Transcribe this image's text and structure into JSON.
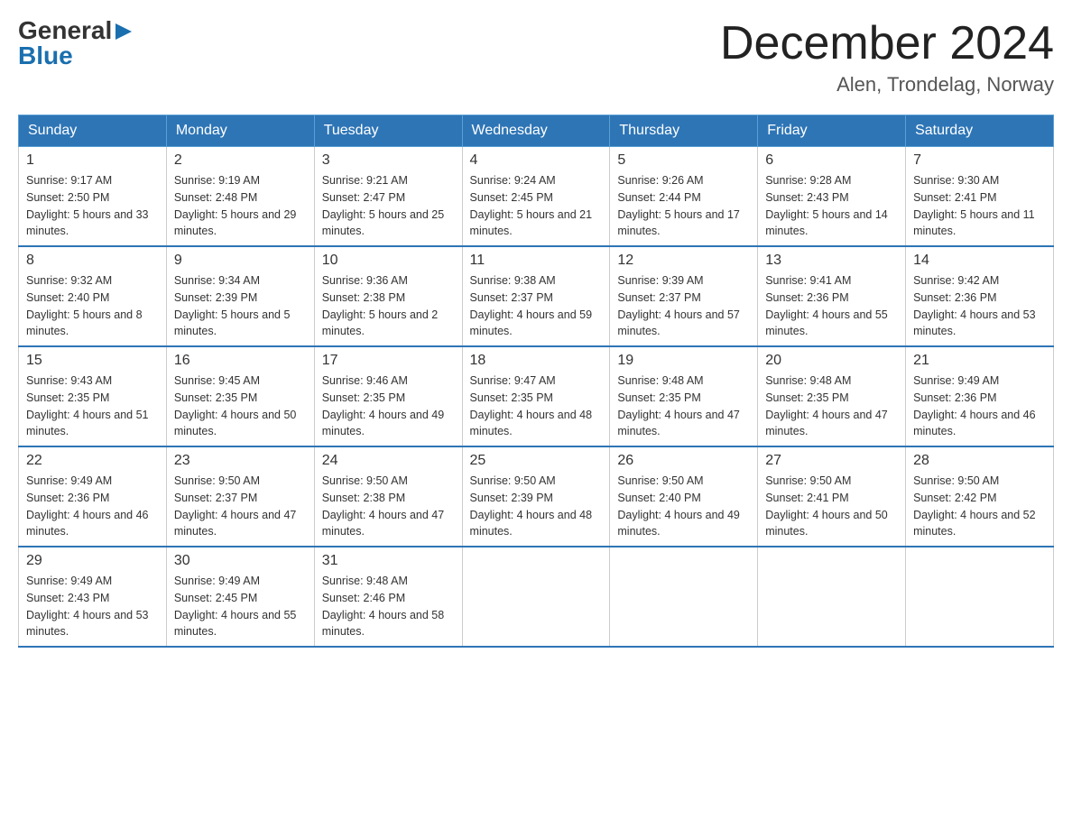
{
  "logo": {
    "general": "General",
    "arrow": "▶",
    "blue": "Blue"
  },
  "title": {
    "month": "December 2024",
    "location": "Alen, Trondelag, Norway"
  },
  "headers": [
    "Sunday",
    "Monday",
    "Tuesday",
    "Wednesday",
    "Thursday",
    "Friday",
    "Saturday"
  ],
  "weeks": [
    [
      {
        "day": "1",
        "sunrise": "9:17 AM",
        "sunset": "2:50 PM",
        "daylight": "5 hours and 33 minutes."
      },
      {
        "day": "2",
        "sunrise": "9:19 AM",
        "sunset": "2:48 PM",
        "daylight": "5 hours and 29 minutes."
      },
      {
        "day": "3",
        "sunrise": "9:21 AM",
        "sunset": "2:47 PM",
        "daylight": "5 hours and 25 minutes."
      },
      {
        "day": "4",
        "sunrise": "9:24 AM",
        "sunset": "2:45 PM",
        "daylight": "5 hours and 21 minutes."
      },
      {
        "day": "5",
        "sunrise": "9:26 AM",
        "sunset": "2:44 PM",
        "daylight": "5 hours and 17 minutes."
      },
      {
        "day": "6",
        "sunrise": "9:28 AM",
        "sunset": "2:43 PM",
        "daylight": "5 hours and 14 minutes."
      },
      {
        "day": "7",
        "sunrise": "9:30 AM",
        "sunset": "2:41 PM",
        "daylight": "5 hours and 11 minutes."
      }
    ],
    [
      {
        "day": "8",
        "sunrise": "9:32 AM",
        "sunset": "2:40 PM",
        "daylight": "5 hours and 8 minutes."
      },
      {
        "day": "9",
        "sunrise": "9:34 AM",
        "sunset": "2:39 PM",
        "daylight": "5 hours and 5 minutes."
      },
      {
        "day": "10",
        "sunrise": "9:36 AM",
        "sunset": "2:38 PM",
        "daylight": "5 hours and 2 minutes."
      },
      {
        "day": "11",
        "sunrise": "9:38 AM",
        "sunset": "2:37 PM",
        "daylight": "4 hours and 59 minutes."
      },
      {
        "day": "12",
        "sunrise": "9:39 AM",
        "sunset": "2:37 PM",
        "daylight": "4 hours and 57 minutes."
      },
      {
        "day": "13",
        "sunrise": "9:41 AM",
        "sunset": "2:36 PM",
        "daylight": "4 hours and 55 minutes."
      },
      {
        "day": "14",
        "sunrise": "9:42 AM",
        "sunset": "2:36 PM",
        "daylight": "4 hours and 53 minutes."
      }
    ],
    [
      {
        "day": "15",
        "sunrise": "9:43 AM",
        "sunset": "2:35 PM",
        "daylight": "4 hours and 51 minutes."
      },
      {
        "day": "16",
        "sunrise": "9:45 AM",
        "sunset": "2:35 PM",
        "daylight": "4 hours and 50 minutes."
      },
      {
        "day": "17",
        "sunrise": "9:46 AM",
        "sunset": "2:35 PM",
        "daylight": "4 hours and 49 minutes."
      },
      {
        "day": "18",
        "sunrise": "9:47 AM",
        "sunset": "2:35 PM",
        "daylight": "4 hours and 48 minutes."
      },
      {
        "day": "19",
        "sunrise": "9:48 AM",
        "sunset": "2:35 PM",
        "daylight": "4 hours and 47 minutes."
      },
      {
        "day": "20",
        "sunrise": "9:48 AM",
        "sunset": "2:35 PM",
        "daylight": "4 hours and 47 minutes."
      },
      {
        "day": "21",
        "sunrise": "9:49 AM",
        "sunset": "2:36 PM",
        "daylight": "4 hours and 46 minutes."
      }
    ],
    [
      {
        "day": "22",
        "sunrise": "9:49 AM",
        "sunset": "2:36 PM",
        "daylight": "4 hours and 46 minutes."
      },
      {
        "day": "23",
        "sunrise": "9:50 AM",
        "sunset": "2:37 PM",
        "daylight": "4 hours and 47 minutes."
      },
      {
        "day": "24",
        "sunrise": "9:50 AM",
        "sunset": "2:38 PM",
        "daylight": "4 hours and 47 minutes."
      },
      {
        "day": "25",
        "sunrise": "9:50 AM",
        "sunset": "2:39 PM",
        "daylight": "4 hours and 48 minutes."
      },
      {
        "day": "26",
        "sunrise": "9:50 AM",
        "sunset": "2:40 PM",
        "daylight": "4 hours and 49 minutes."
      },
      {
        "day": "27",
        "sunrise": "9:50 AM",
        "sunset": "2:41 PM",
        "daylight": "4 hours and 50 minutes."
      },
      {
        "day": "28",
        "sunrise": "9:50 AM",
        "sunset": "2:42 PM",
        "daylight": "4 hours and 52 minutes."
      }
    ],
    [
      {
        "day": "29",
        "sunrise": "9:49 AM",
        "sunset": "2:43 PM",
        "daylight": "4 hours and 53 minutes."
      },
      {
        "day": "30",
        "sunrise": "9:49 AM",
        "sunset": "2:45 PM",
        "daylight": "4 hours and 55 minutes."
      },
      {
        "day": "31",
        "sunrise": "9:48 AM",
        "sunset": "2:46 PM",
        "daylight": "4 hours and 58 minutes."
      },
      null,
      null,
      null,
      null
    ]
  ]
}
